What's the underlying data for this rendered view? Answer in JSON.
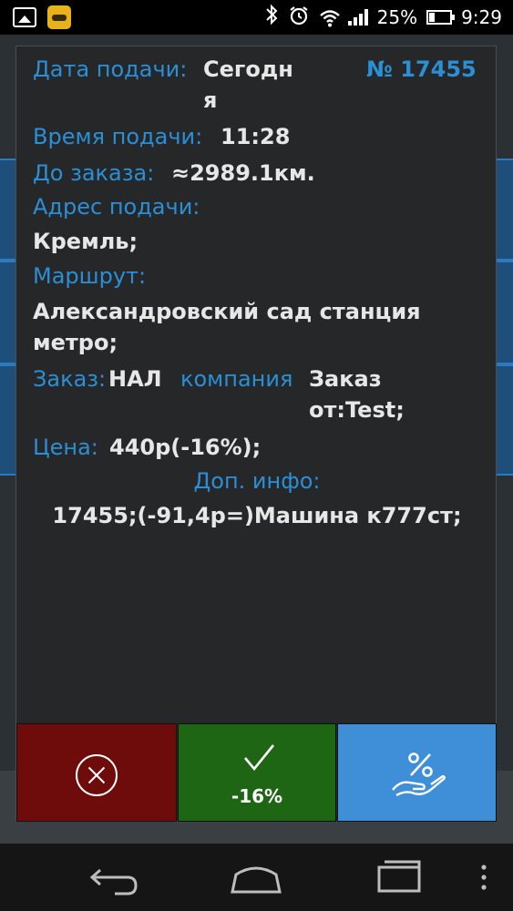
{
  "status_bar": {
    "battery": "25%",
    "time": "9:29",
    "icons": [
      "image-notification-icon",
      "taxi-app-notification-icon",
      "bluetooth-icon",
      "alarm-icon",
      "wifi-icon",
      "signal-icon",
      "battery-icon"
    ]
  },
  "order": {
    "date_label": "Дата подачи:",
    "date_value_line1": "Сегодн",
    "date_value_line2": "я",
    "number": "№ 17455",
    "time_label": "Время подачи:",
    "time_value": "11:28",
    "distance_label": "До заказа:",
    "distance_value": "≈2989.1км.",
    "address_label": "Адрес подачи:",
    "address_value": "Кремль;",
    "route_label": "Маршрут:",
    "route_value_line1": "Александровский сад станция",
    "route_value_line2": "метро;",
    "order_label": "Заказ:",
    "payment_value": "НАЛ",
    "company_label": "компания",
    "company_value_line1": "Заказ",
    "company_value_line2": "от:Test;",
    "price_label": "Цена:",
    "price_value": "440р(-16%);",
    "extra_label": "Доп. инфо:",
    "extra_value": "17455;(-91,4р=)Машина к777ст;"
  },
  "actions": {
    "accept_label": "-16%"
  },
  "colors": {
    "label_blue": "#2b8fd6",
    "reject_red": "#6e0c0c",
    "accept_green": "#1e6614",
    "discount_blue": "#3f8ed8"
  }
}
